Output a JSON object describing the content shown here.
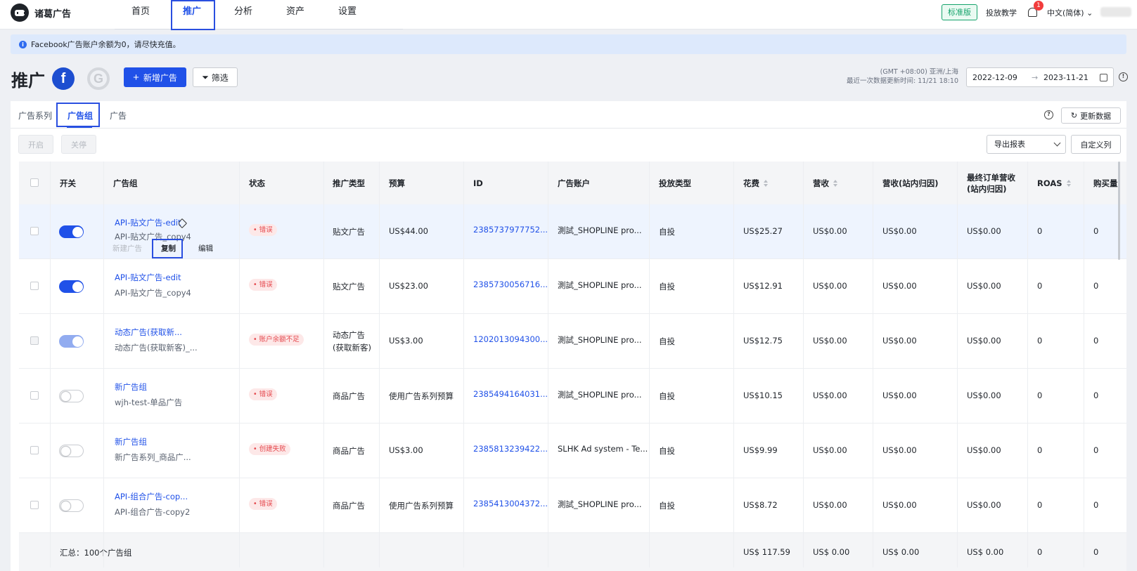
{
  "app": {
    "logo_text": "诸葛广告"
  },
  "nav": {
    "items": [
      "首页",
      "推广",
      "分析",
      "资产",
      "设置"
    ],
    "active": "推广"
  },
  "topbar": {
    "plan": "标准版",
    "tutorial": "投放教学",
    "notifications": "1",
    "language": "中文(简体)"
  },
  "notice": {
    "text": "Facebook广告账户余额为0，请尽快充值。"
  },
  "header": {
    "title": "推广",
    "fb_letter": "f",
    "google_letter": "G",
    "add_button": "新增广告",
    "filter_button": "筛选",
    "timezone": "(GMT +08:00) 亚洲/上海",
    "last_update": "最近一次数据更新时间: 11/21 18:10",
    "date_start": "2022-12-09",
    "date_end": "2023-11-21"
  },
  "tabs": [
    "广告系列",
    "广告组",
    "广告"
  ],
  "toolbar": {
    "enable": "开启",
    "disable": "关停",
    "export": "导出报表",
    "custom_columns": "自定义列",
    "refresh": "更新数据"
  },
  "table": {
    "headers": {
      "switch": "开关",
      "adgroup": "广告组",
      "status": "状态",
      "promo_type": "推广类型",
      "budget": "预算",
      "id": "ID",
      "account": "广告账户",
      "delivery": "投放类型",
      "spend": "花费",
      "revenue": "营收",
      "revenue_site": "营收(站内归因)",
      "final_revenue_1": "最终订单营收",
      "final_revenue_2": "(站内归因)",
      "roas": "ROAS",
      "purchases": "购买量"
    },
    "rows": [
      {
        "name": "API-贴文广告-edit",
        "campaign": "API-贴文广告_copy4",
        "status": "错误",
        "type": "贴文广告",
        "budget": "US$44.00",
        "id": "2385737977752...",
        "account": "測試_SHOPLINE pro...",
        "delivery": "自投",
        "spend": "US$25.27",
        "revenue": "US$0.00",
        "revenue_site": "US$0.00",
        "final_revenue": "US$0.00",
        "roas": "0",
        "purchases": "0",
        "switch": "on"
      },
      {
        "name": "API-贴文广告-edit",
        "campaign": "API-贴文广告_copy4",
        "status": "错误",
        "type": "贴文广告",
        "budget": "US$23.00",
        "id": "2385730056716...",
        "account": "測試_SHOPLINE pro...",
        "delivery": "自投",
        "spend": "US$12.91",
        "revenue": "US$0.00",
        "revenue_site": "US$0.00",
        "final_revenue": "US$0.00",
        "roas": "0",
        "purchases": "0",
        "switch": "on"
      },
      {
        "name": "动态广告(获取新...",
        "campaign": "动态广告(获取新客)_...",
        "status": "账户余额不足",
        "type": "动态广告",
        "type2": "(获取新客)",
        "budget": "US$3.00",
        "id": "1202013094300...",
        "account": "測試_SHOPLINE pro...",
        "delivery": "自投",
        "spend": "US$12.75",
        "revenue": "US$0.00",
        "revenue_site": "US$0.00",
        "final_revenue": "US$0.00",
        "roas": "0",
        "purchases": "0",
        "switch": "dim"
      },
      {
        "name": "新广告组",
        "campaign": "wjh-test-单品广告",
        "status": "错误",
        "type": "商品广告",
        "budget": "使用广告系列预算",
        "id": "2385494164031...",
        "account": "測試_SHOPLINE pro...",
        "delivery": "自投",
        "spend": "US$10.15",
        "revenue": "US$0.00",
        "revenue_site": "US$0.00",
        "final_revenue": "US$0.00",
        "roas": "0",
        "purchases": "0",
        "switch": "off"
      },
      {
        "name": "新广告组",
        "campaign": "新广告系列_商品广...",
        "status": "创建失败",
        "type": "商品广告",
        "budget": "US$3.00",
        "id": "2385813239422...",
        "account": "SLHK Ad system - Te...",
        "delivery": "自投",
        "spend": "US$9.99",
        "revenue": "US$0.00",
        "revenue_site": "US$0.00",
        "final_revenue": "US$0.00",
        "roas": "0",
        "purchases": "0",
        "switch": "off"
      },
      {
        "name": "API-组合广告-cop...",
        "campaign": "API-组合广告-copy2",
        "status": "错误",
        "type": "商品广告",
        "budget": "使用广告系列预算",
        "id": "2385413004372...",
        "account": "測試_SHOPLINE pro...",
        "delivery": "自投",
        "spend": "US$8.72",
        "revenue": "US$0.00",
        "revenue_site": "US$0.00",
        "final_revenue": "US$0.00",
        "roas": "0",
        "purchases": "0",
        "switch": "off"
      }
    ],
    "row_actions": {
      "new_ad": "新建广告",
      "copy": "复制",
      "edit": "编辑"
    },
    "summary": {
      "label": "汇总：100个广告组",
      "spend": "US$ 117.59",
      "revenue": "US$ 0.00",
      "revenue_site": "US$ 0.00",
      "final_revenue": "US$ 0.00",
      "roas": "0",
      "purchases": "0"
    }
  },
  "colors": {
    "primary": "#2051e8",
    "error": "#e5484d",
    "success": "#15a36b"
  }
}
